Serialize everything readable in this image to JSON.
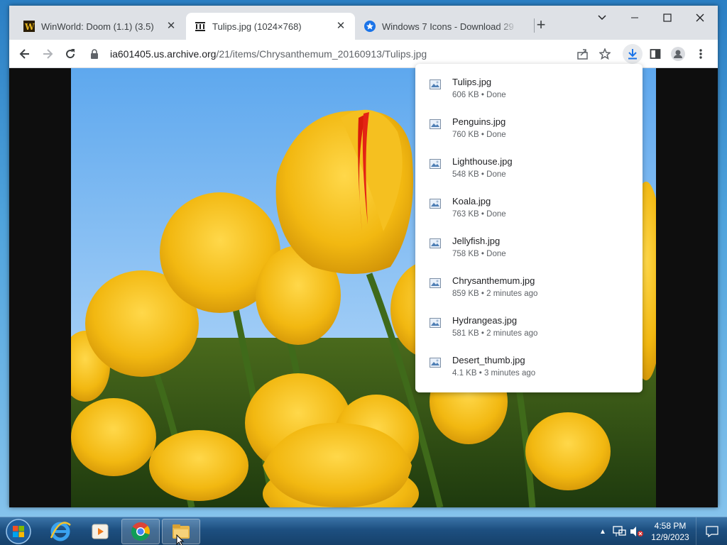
{
  "browser": {
    "tabs": [
      {
        "title": "WinWorld: Doom (1.1) (3.5)",
        "icon": "winworld-icon",
        "active": false
      },
      {
        "title": "Tulips.jpg (1024×768)",
        "icon": "archive-icon",
        "active": true
      },
      {
        "title": "Windows 7 Icons - Download 29",
        "icon": "star-badge-icon",
        "active": false
      }
    ],
    "new_tab_label": "+",
    "url_host": "ia601405.us.archive.org",
    "url_path": "/21/items/Chrysanthemum_20160913/Tulips.jpg"
  },
  "downloads": [
    {
      "name": "Tulips.jpg",
      "status": "606 KB • Done"
    },
    {
      "name": "Penguins.jpg",
      "status": "760 KB • Done"
    },
    {
      "name": "Lighthouse.jpg",
      "status": "548 KB • Done"
    },
    {
      "name": "Koala.jpg",
      "status": "763 KB • Done"
    },
    {
      "name": "Jellyfish.jpg",
      "status": "758 KB • Done"
    },
    {
      "name": "Chrysanthemum.jpg",
      "status": "859 KB • 2 minutes ago"
    },
    {
      "name": "Hydrangeas.jpg",
      "status": "581 KB • 2 minutes ago"
    },
    {
      "name": "Desert_thumb.jpg",
      "status": "4.1 KB • 3 minutes ago"
    }
  ],
  "taskbar": {
    "apps": [
      "internet-explorer-icon",
      "media-player-icon",
      "chrome-icon",
      "file-explorer-icon"
    ],
    "time": "4:58 PM",
    "date": "12/9/2023"
  },
  "colors": {
    "tab_strip": "#dee1e6",
    "taskbar": "#1d4f80",
    "tulip": "#f2b811"
  }
}
